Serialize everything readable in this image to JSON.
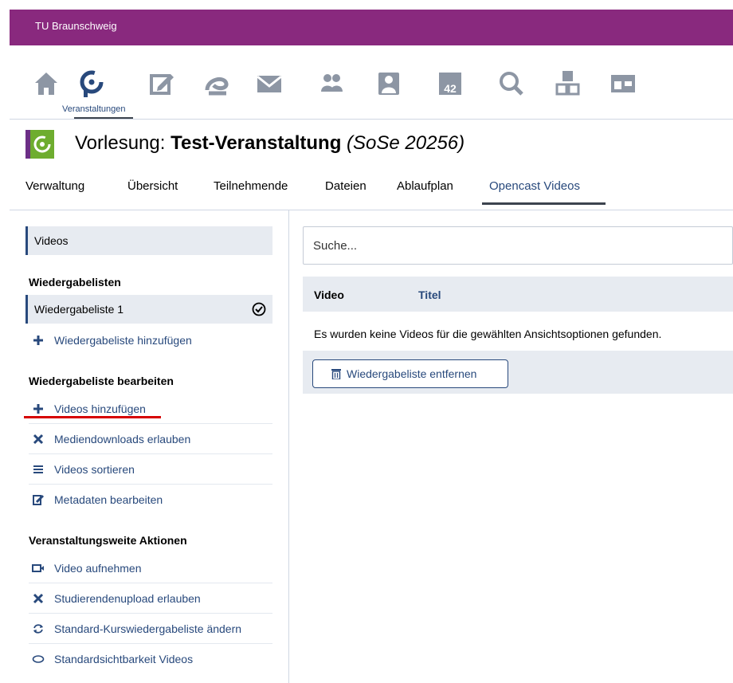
{
  "header": {
    "org_name": "TU Braunschweig",
    "accent_color": "#89297e"
  },
  "nav": {
    "icons": [
      "home-icon",
      "courses-icon",
      "news-icon",
      "community-icon",
      "messages-icon",
      "contacts-icon",
      "profile-icon",
      "calendar-icon",
      "search-icon",
      "tools-icon",
      "admin-icon"
    ],
    "active_label": "Veranstaltungen"
  },
  "course": {
    "prefix": "Vorlesung: ",
    "name": "Test-Veranstaltung",
    "semester": "(SoSe 20256)",
    "icon_color": "#6ead2f"
  },
  "tabs": [
    "Verwaltung",
    "Übersicht",
    "Teilnehmende",
    "Dateien",
    "Ablaufplan",
    "Opencast Videos"
  ],
  "active_tab": "Opencast Videos",
  "sidebar": {
    "videos_label": "Videos",
    "playlists_heading": "Wiedergabelisten",
    "playlist_item": "Wiedergabeliste 1",
    "add_playlist": "Wiedergabeliste hinzufügen",
    "edit_heading": "Wiedergabeliste bearbeiten",
    "edit_items": [
      "Videos hinzufügen",
      "Mediendownloads erlauben",
      "Videos sortieren",
      "Metadaten bearbeiten"
    ],
    "course_heading": "Veranstaltungsweite Aktionen",
    "course_items": [
      "Video aufnehmen",
      "Studierendenupload erlauben",
      "Standard-Kurswiedergabeliste ändern",
      "Standardsichtbarkeit Videos"
    ]
  },
  "main": {
    "search_placeholder": "Suche...",
    "col_video": "Video",
    "col_title": "Titel",
    "empty_message": "Es wurden keine Videos für die gewählten Ansichtsoptionen gefunden.",
    "remove_button": "Wiedergabeliste entfernen"
  }
}
